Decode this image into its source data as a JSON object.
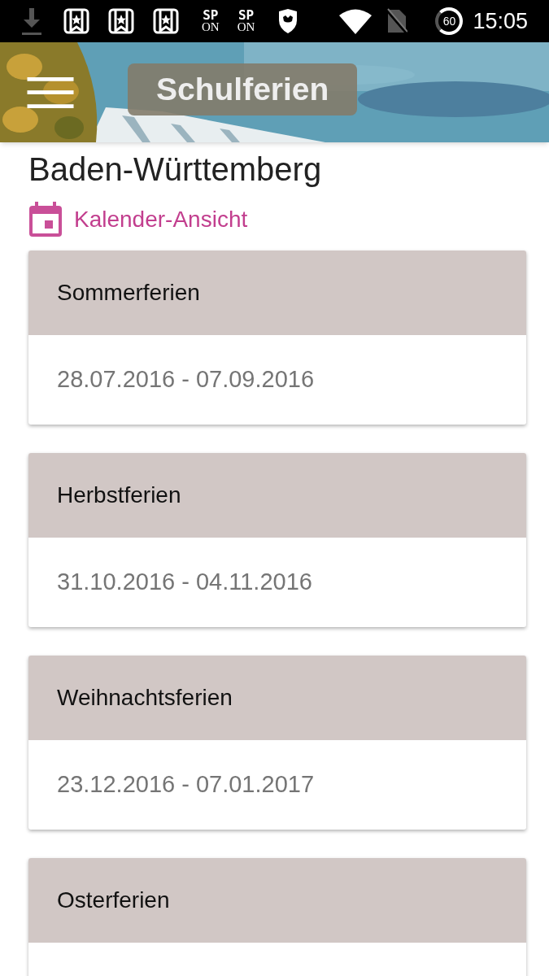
{
  "status_bar": {
    "indicators": [
      {
        "top": "SP",
        "bottom": "ON"
      },
      {
        "top": "SP",
        "bottom": "ON"
      }
    ],
    "battery_percent": "60",
    "time": "15:05"
  },
  "app_bar": {
    "title": "Schulferien"
  },
  "state_name": "Baden-Württemberg",
  "calendar_link": "Kalender-Ansicht",
  "holidays": [
    {
      "name": "Sommerferien",
      "dates": "28.07.2016 - 07.09.2016"
    },
    {
      "name": "Herbstferien",
      "dates": "31.10.2016 - 04.11.2016"
    },
    {
      "name": "Weihnachtsferien",
      "dates": "23.12.2016 - 07.01.2017"
    },
    {
      "name": "Osterferien"
    }
  ]
}
